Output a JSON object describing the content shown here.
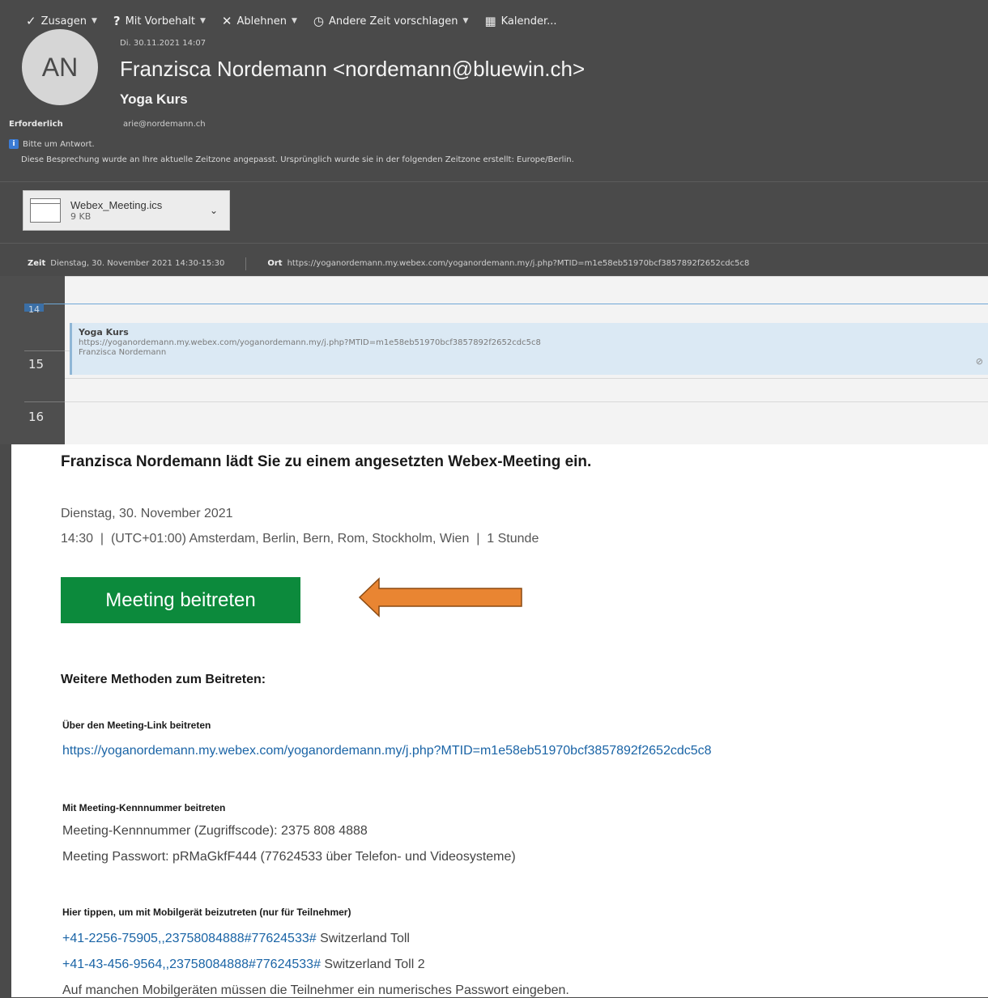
{
  "toolbar": {
    "accept": "Zusagen",
    "tentative": "Mit Vorbehalt",
    "decline": "Ablehnen",
    "propose": "Andere Zeit vorschlagen",
    "calendar": "Kalender..."
  },
  "header": {
    "avatar_initials": "AN",
    "date": "Di. 30.11.2021 14:07",
    "sender": "Franzisca Nordemann <nordemann@bluewin.ch>",
    "subject": "Yoga Kurs",
    "required_label": "Erforderlich",
    "required_email": "arie@nordemann.ch",
    "info_line1": "Bitte um Antwort.",
    "info_line2": "Diese Besprechung wurde an Ihre aktuelle Zeitzone angepasst. Ursprünglich wurde sie in der folgenden Zeitzone erstellt: Europe/Berlin."
  },
  "attachment": {
    "name": "Webex_Meeting.ics",
    "size": "9 KB"
  },
  "meeting_meta": {
    "time_label": "Zeit",
    "time_value": "Dienstag, 30. November 2021 14:30-15:30",
    "location_label": "Ort",
    "location_value": "https://yoganordemann.my.webex.com/yoganordemann.my/j.php?MTID=m1e58eb51970bcf3857892f2652cdc5c8"
  },
  "calendar": {
    "hours": [
      "14",
      "15",
      "16"
    ],
    "event": {
      "title": "Yoga Kurs",
      "location": "https://yoganordemann.my.webex.com/yoganordemann.my/j.php?MTID=m1e58eb51970bcf3857892f2652cdc5c8",
      "organizer": "Franzisca Nordemann"
    }
  },
  "body": {
    "heading": "Franzisca Nordemann lädt Sie zu einem angesetzten Webex-Meeting ein.",
    "date": "Dienstag, 30. November 2021",
    "time": "14:30  |  (UTC+01:00) Amsterdam, Berlin, Bern, Rom, Stockholm, Wien  |  1 Stunde",
    "join_button": "Meeting beitreten",
    "methods_heading": "Weitere Methoden zum Beitreten:",
    "link_label": "Über den Meeting-Link beitreten",
    "link": "https://yoganordemann.my.webex.com/yoganordemann.my/j.php?MTID=m1e58eb51970bcf3857892f2652cdc5c8",
    "id_label": "Mit Meeting-Kennnummer beitreten",
    "id_line": "Meeting-Kennnummer (Zugriffscode): 2375 808 4888",
    "password_line": "Meeting Passwort: pRMaGkfF444 (77624533 über Telefon- und Videosysteme)",
    "mobile_label": "Hier tippen, um mit Mobilgerät beizutreten (nur für Teilnehmer)",
    "phone1_number": "+41-2256-75905,,23758084888#77624533#",
    "phone1_suffix": " Switzerland Toll",
    "phone2_number": "+41-43-456-9564,,23758084888#77624533#",
    "phone2_suffix": " Switzerland Toll 2",
    "note": "Auf manchen Mobilgeräten müssen die Teilnehmer ein numerisches Passwort eingeben."
  },
  "colors": {
    "accent_green": "#0c8a3c",
    "link_blue": "#1a64a6",
    "annotation_arrow": "#e98532"
  }
}
